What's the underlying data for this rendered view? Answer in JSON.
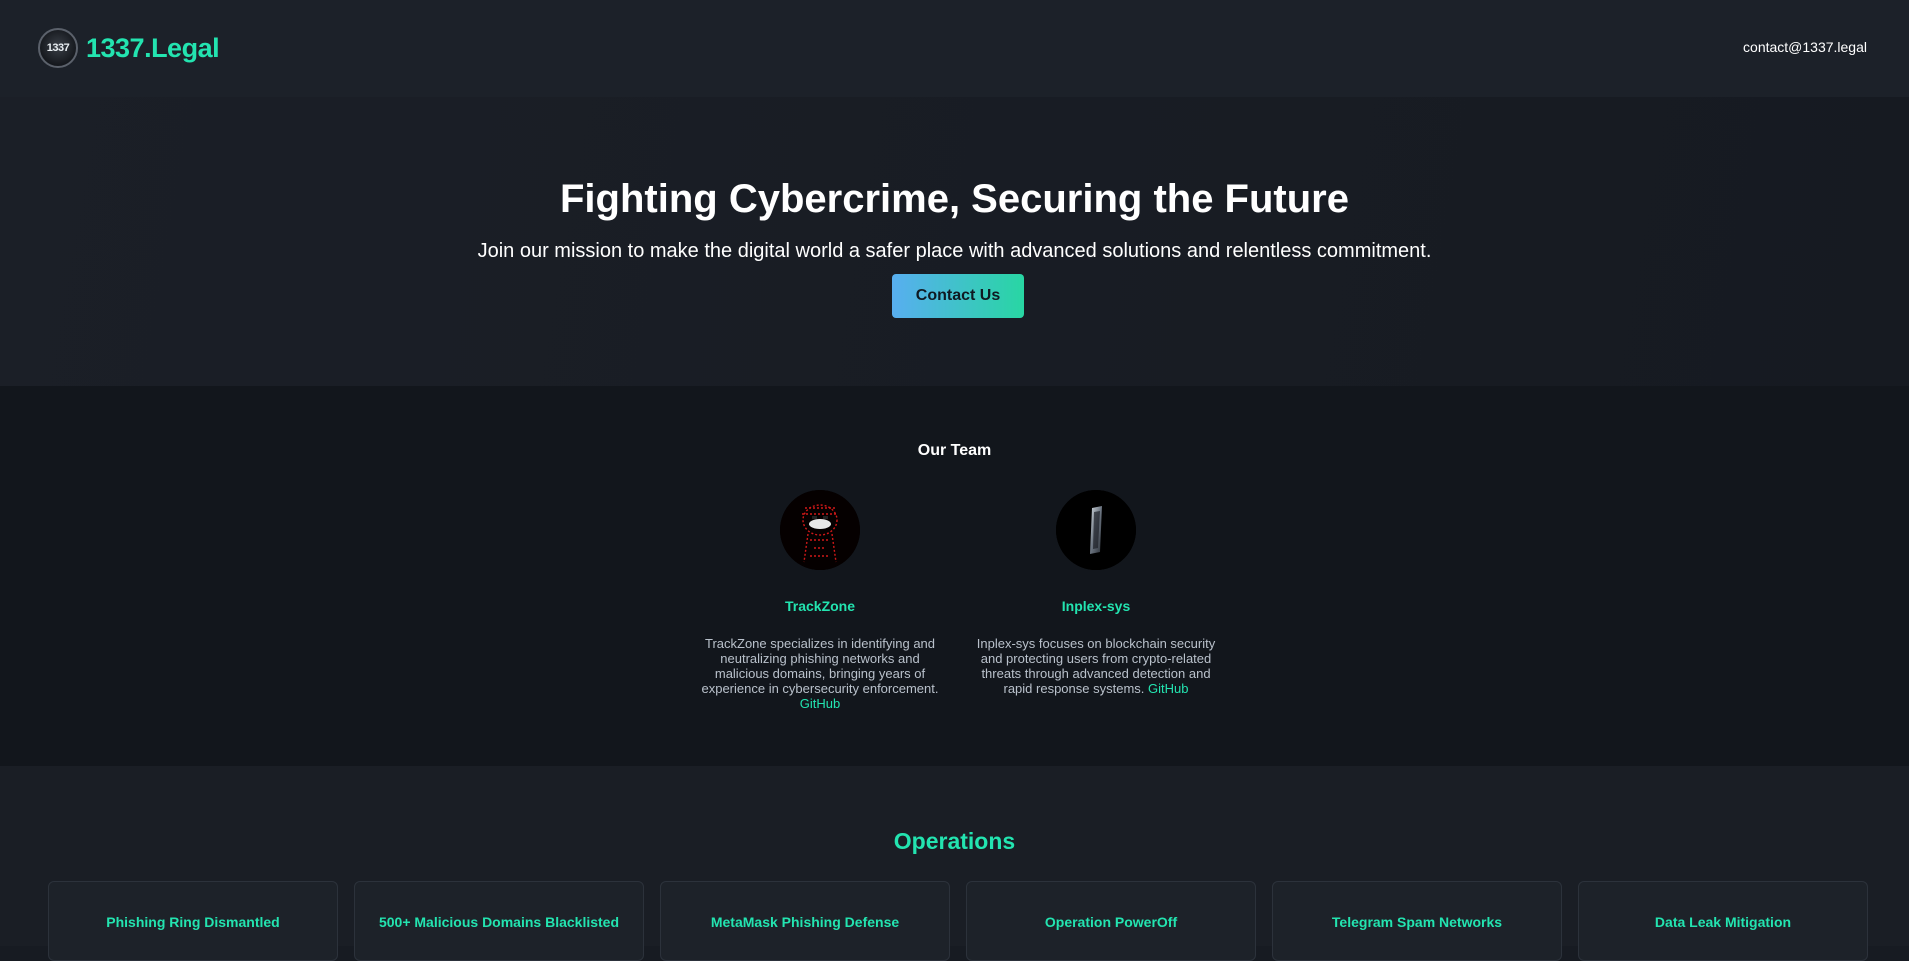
{
  "header": {
    "logo_text": "1337",
    "brand": "1337.Legal",
    "email": "contact@1337.legal"
  },
  "hero": {
    "title": "Fighting Cybercrime, Securing the Future",
    "subtitle": "Join our mission to make the digital world a safer place with advanced solutions and relentless commitment.",
    "cta_label": "Contact Us"
  },
  "team": {
    "title": "Our Team",
    "members": [
      {
        "name": "TrackZone",
        "bio": "TrackZone specializes in identifying and neutralizing phishing networks and malicious domains, bringing years of experience in cybersecurity enforcement.",
        "link_label": "GitHub"
      },
      {
        "name": "Inplex-sys",
        "bio": "Inplex-sys focuses on blockchain security and protecting users from crypto-related threats through advanced detection and rapid response systems.",
        "link_label": "GitHub"
      }
    ]
  },
  "operations": {
    "title": "Operations",
    "cards": [
      {
        "title": "Phishing Ring Dismantled"
      },
      {
        "title": "500+ Malicious Domains Blacklisted"
      },
      {
        "title": "MetaMask Phishing Defense"
      },
      {
        "title": "Operation PowerOff"
      },
      {
        "title": "Telegram Spam Networks"
      },
      {
        "title": "Data Leak Mitigation"
      }
    ]
  },
  "colors": {
    "accent": "#23e4b0",
    "background": "#171b22",
    "button_gradient_start": "#58aef0",
    "button_gradient_end": "#28d6a3"
  }
}
